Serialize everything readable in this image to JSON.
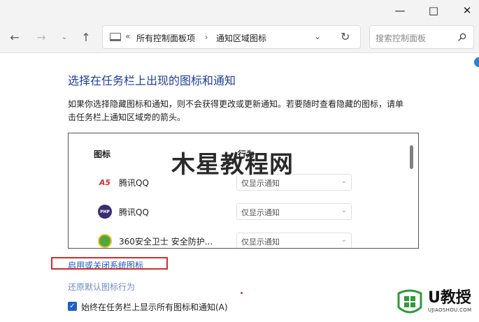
{
  "window": {
    "minimize_glyph": "—",
    "maximize_glyph": "□",
    "close_glyph": "✕"
  },
  "nav": {
    "back_glyph": "←",
    "forward_glyph": "→",
    "recent_glyph": "⌄",
    "up_glyph": "↑",
    "breadcrumb_prefix": "«",
    "breadcrumb": [
      "所有控制面板项",
      "通知区域图标"
    ],
    "breadcrumb_separator": "›",
    "dropdown_glyph": "⌄",
    "refresh_glyph": "↻",
    "search_placeholder": "搜索控制面板",
    "icons": [
      "pc-icon",
      "search-icon",
      "refresh-icon"
    ]
  },
  "main": {
    "title": "选择在任务栏上出现的图标和通知",
    "description": "如果你选择隐藏图标和通知，则不会获得更改或更新通知。若要随时查看隐藏的图标，请单击任务栏上通知区域旁的箭头。",
    "columns": {
      "icon": "图标",
      "behavior": "行为"
    },
    "rows": [
      {
        "icon_text": "A5",
        "icon": "tencent-qq-icon",
        "name": "腾讯QQ",
        "behavior": "仅显示通知"
      },
      {
        "icon_text": "PHP",
        "icon": "php-icon",
        "name": "腾讯QQ",
        "behavior": "仅显示通知"
      },
      {
        "icon_text": "",
        "icon": "360-safe-icon",
        "name": "360安全卫士 安全防护...",
        "behavior": "仅显示通知"
      }
    ],
    "select_arrow": "⌄",
    "watermark": "木星教程网",
    "link_system_icons": "启用或关闭系统图标",
    "link_restore": "还原默认图标行为",
    "checkbox_checked": true,
    "checkbox_glyph": "✓",
    "checkbox_label": "始终在任务栏上显示所有图标和通知(A)"
  },
  "logo": {
    "text": "U教授",
    "subtext": "UJIAOSHOU.COM"
  },
  "colors": {
    "title_blue": "#1e3f99",
    "link_blue": "#1f57c4",
    "highlight_red": "#d62b2b",
    "logo_green": "#2f9b3a"
  }
}
